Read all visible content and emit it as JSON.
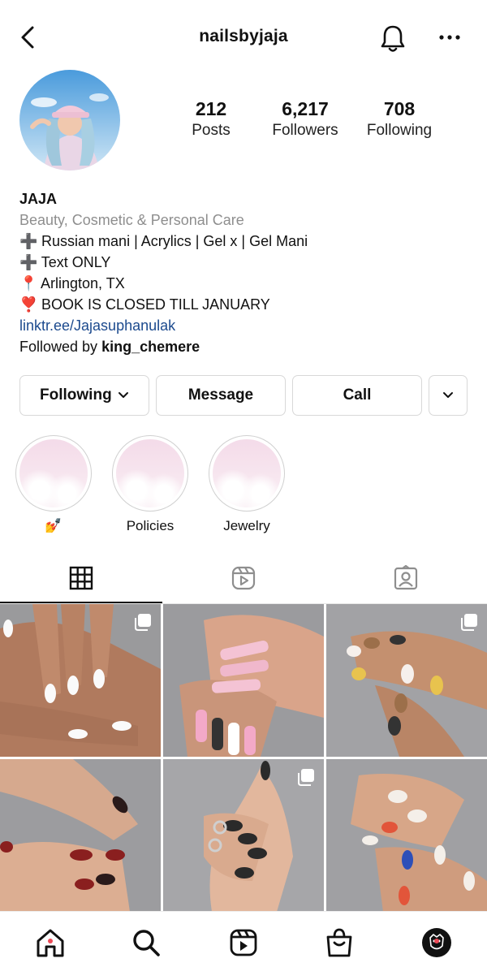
{
  "header": {
    "username": "nailsbyjaja",
    "icons": {
      "back": "chevron-left-icon",
      "notifications": "bell-icon",
      "more": "more-horizontal-icon"
    }
  },
  "profile": {
    "stats": {
      "posts": {
        "value": "212",
        "label": "Posts"
      },
      "followers": {
        "value": "6,217",
        "label": "Followers"
      },
      "following": {
        "value": "708",
        "label": "Following"
      }
    },
    "name": "JAJA",
    "category": "Beauty, Cosmetic & Personal Care",
    "bio_lines": [
      {
        "icon": "➕",
        "text": "Russian mani | Acrylics | Gel x | Gel Mani"
      },
      {
        "icon": "➕",
        "text": "Text ONLY"
      },
      {
        "icon": "📍",
        "text": "Arlington, TX"
      },
      {
        "icon": "❣️",
        "text": "BOOK IS CLOSED TILL JANUARY"
      }
    ],
    "link": "linktr.ee/Jajasuphanulak",
    "followed_by_prefix": "Followed by",
    "followed_by_user": "king_chemere"
  },
  "actions": {
    "following": "Following",
    "message": "Message",
    "call": "Call"
  },
  "highlights": [
    {
      "label": "💅"
    },
    {
      "label": "Policies"
    },
    {
      "label": "Jewelry"
    }
  ],
  "tabs": [
    {
      "name": "grid",
      "icon": "grid-icon",
      "active": true
    },
    {
      "name": "reels",
      "icon": "reels-icon",
      "active": false
    },
    {
      "name": "tagged",
      "icon": "tagged-icon",
      "active": false
    }
  ],
  "posts_count_shown": 6,
  "bottom_nav": [
    {
      "name": "home",
      "icon": "home-icon",
      "has_dot": true
    },
    {
      "name": "search",
      "icon": "search-icon",
      "has_dot": false
    },
    {
      "name": "reels",
      "icon": "reels-icon",
      "has_dot": false
    },
    {
      "name": "shop",
      "icon": "shop-bag-icon",
      "has_dot": false
    },
    {
      "name": "profile",
      "icon": "profile-avatar-icon",
      "has_dot": true
    }
  ],
  "colors": {
    "accent_link": "#1c4a8e",
    "notification_dot": "#ed4956",
    "muted": "#8e8e8e"
  }
}
